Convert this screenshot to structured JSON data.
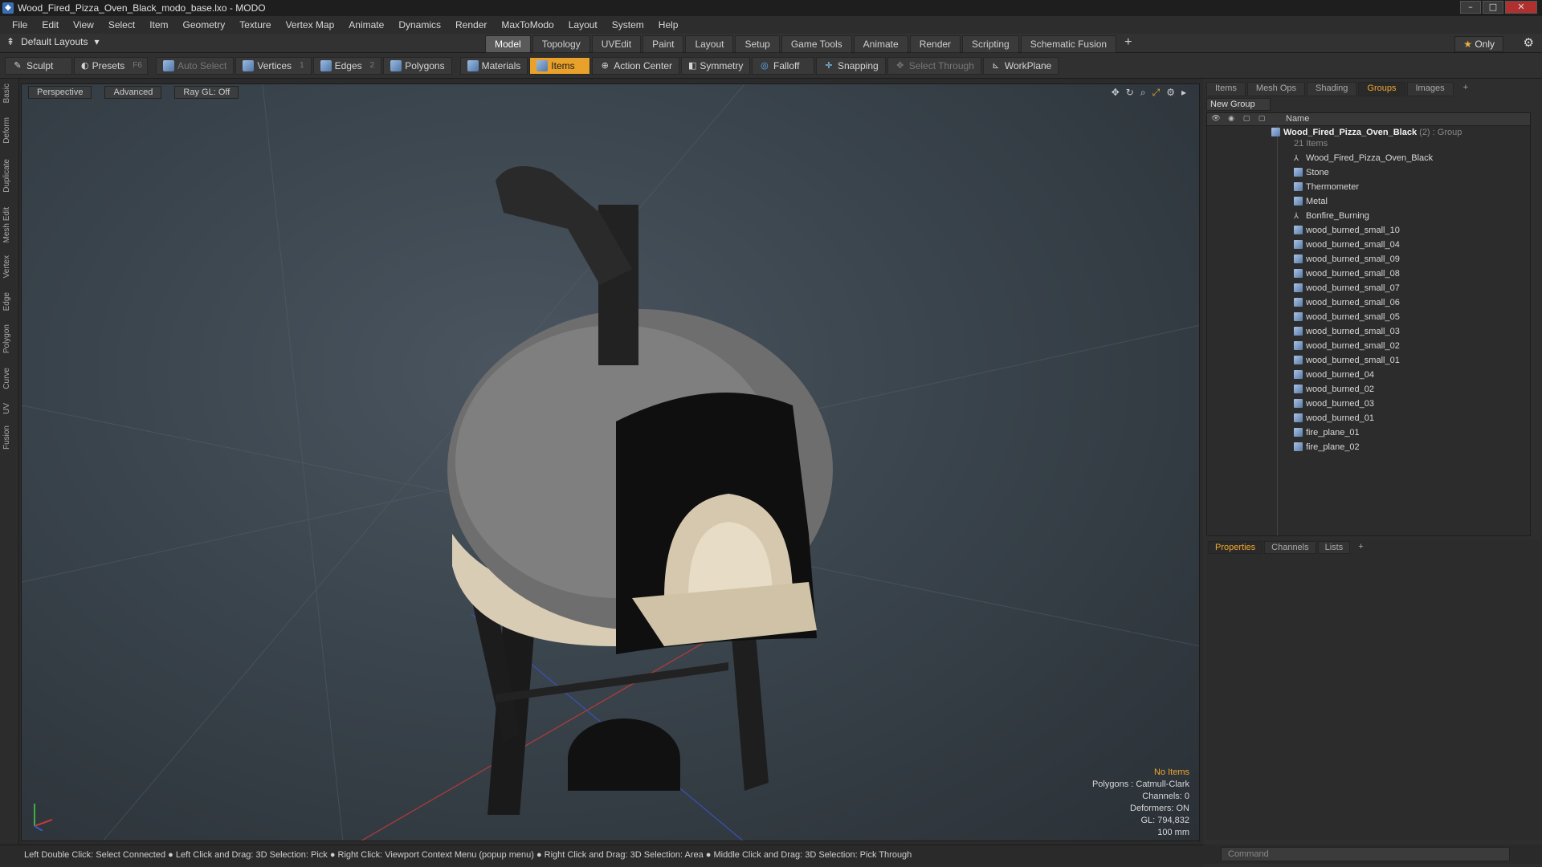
{
  "window": {
    "title": "Wood_Fired_Pizza_Oven_Black_modo_base.lxo - MODO"
  },
  "menu": [
    "File",
    "Edit",
    "View",
    "Select",
    "Item",
    "Geometry",
    "Texture",
    "Vertex Map",
    "Animate",
    "Dynamics",
    "Render",
    "MaxToModo",
    "Layout",
    "System",
    "Help"
  ],
  "layouts": {
    "label": "Default Layouts"
  },
  "tabs": [
    "Model",
    "Topology",
    "UVEdit",
    "Paint",
    "Layout",
    "Setup",
    "Game Tools",
    "Animate",
    "Render",
    "Scripting",
    "Schematic Fusion"
  ],
  "only_label": "Only",
  "toolbar": {
    "sculpt": "Sculpt",
    "presets": "Presets",
    "presets_key": "F6",
    "auto_select": "Auto Select",
    "vertices": "Vertices",
    "vertices_num": "1",
    "edges": "Edges",
    "edges_num": "2",
    "polygons": "Polygons",
    "materials": "Materials",
    "items": "Items",
    "action_center": "Action Center",
    "symmetry": "Symmetry",
    "falloff": "Falloff",
    "snapping": "Snapping",
    "select_through": "Select Through",
    "workplane": "WorkPlane"
  },
  "left_tabs": [
    "Basic",
    "Deform",
    "Duplicate",
    "Mesh Edit",
    "Vertex",
    "Edge",
    "Polygon",
    "Curve",
    "UV",
    "Fusion"
  ],
  "viewport": {
    "perspective": "Perspective",
    "advanced": "Advanced",
    "raygl": "Ray GL: Off",
    "stats": {
      "no_items": "No Items",
      "polygons": "Polygons : Catmull-Clark",
      "channels": "Channels: 0",
      "deformers": "Deformers: ON",
      "gl": "GL: 794,832",
      "scale": "100 mm"
    }
  },
  "statusbar": "Left Double Click: Select Connected ● Left Click and Drag: 3D Selection: Pick ● Right Click: Viewport Context Menu (popup menu) ● Right Click and Drag: 3D Selection: Area ● Middle Click and Drag: 3D Selection: Pick Through",
  "right_tabs": [
    "Items",
    "Mesh Ops",
    "Shading",
    "Groups",
    "Images"
  ],
  "new_group": "New Group",
  "tree": {
    "name_header": "Name",
    "group_name": "Wood_Fired_Pizza_Oven_Black",
    "group_type": "(2) : Group",
    "group_count": "21 Items",
    "items": [
      {
        "name": "Wood_Fired_Pizza_Oven_Black",
        "icon": "locator-icon"
      },
      {
        "name": "Stone",
        "icon": "mesh-icon"
      },
      {
        "name": "Thermometer",
        "icon": "mesh-icon"
      },
      {
        "name": "Metal",
        "icon": "mesh-icon"
      },
      {
        "name": "Bonfire_Burning",
        "icon": "locator-icon"
      },
      {
        "name": "wood_burned_small_10",
        "icon": "mesh-icon"
      },
      {
        "name": "wood_burned_small_04",
        "icon": "mesh-icon"
      },
      {
        "name": "wood_burned_small_09",
        "icon": "mesh-icon"
      },
      {
        "name": "wood_burned_small_08",
        "icon": "mesh-icon"
      },
      {
        "name": "wood_burned_small_07",
        "icon": "mesh-icon"
      },
      {
        "name": "wood_burned_small_06",
        "icon": "mesh-icon"
      },
      {
        "name": "wood_burned_small_05",
        "icon": "mesh-icon"
      },
      {
        "name": "wood_burned_small_03",
        "icon": "mesh-icon"
      },
      {
        "name": "wood_burned_small_02",
        "icon": "mesh-icon"
      },
      {
        "name": "wood_burned_small_01",
        "icon": "mesh-icon"
      },
      {
        "name": "wood_burned_04",
        "icon": "mesh-icon"
      },
      {
        "name": "wood_burned_02",
        "icon": "mesh-icon"
      },
      {
        "name": "wood_burned_03",
        "icon": "mesh-icon"
      },
      {
        "name": "wood_burned_01",
        "icon": "mesh-icon"
      },
      {
        "name": "fire_plane_01",
        "icon": "mesh-icon"
      },
      {
        "name": "fire_plane_02",
        "icon": "mesh-icon"
      }
    ]
  },
  "props_tabs": [
    "Properties",
    "Channels",
    "Lists"
  ],
  "command": {
    "placeholder": "Command"
  },
  "colors": {
    "accent": "#e8a12a",
    "selected_tab": "#f0a830"
  }
}
